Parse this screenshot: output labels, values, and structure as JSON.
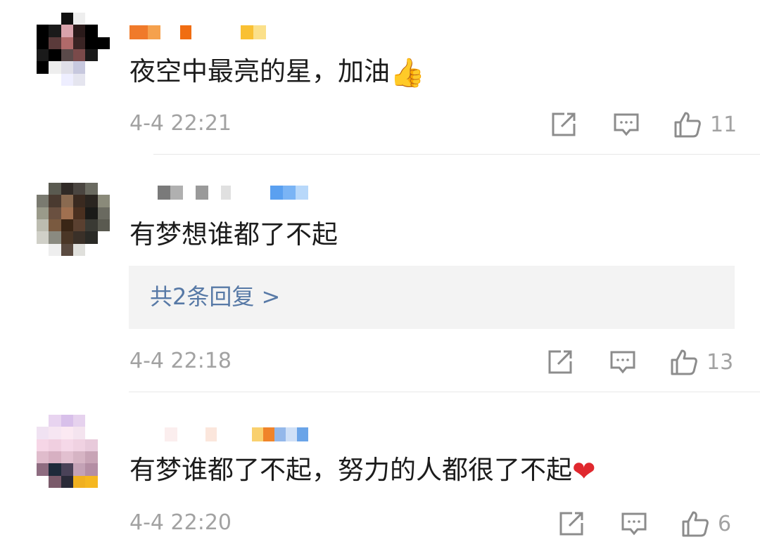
{
  "comments": [
    {
      "name_redacted": true,
      "text": "夜空中最亮的星，加油",
      "emoji": "thumbs-up",
      "time": "4-4 22:21",
      "likes": "11"
    },
    {
      "name_redacted": true,
      "text": "有梦想谁都了不起",
      "emoji": "",
      "reply_link": "共2条回复 >",
      "time": "4-4 22:18",
      "likes": "13"
    },
    {
      "name_redacted": true,
      "text": "有梦谁都了不起，努力的人都很了不起",
      "emoji": "heart",
      "time": "4-4 22:20",
      "likes": "6"
    }
  ],
  "icons": {
    "share": "share-icon",
    "comment": "comment-icon",
    "like": "thumbs-up-icon"
  },
  "colors": {
    "text": "#1c1c1c",
    "meta": "#a2a2a2",
    "link": "#5779a6",
    "reply_bg": "#f3f3f3",
    "divider": "#e8e8e8"
  }
}
